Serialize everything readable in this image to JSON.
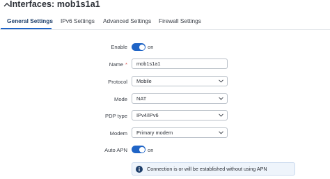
{
  "header": {
    "title": "Interfaces: mob1s1a1",
    "collapse_icon": "chevron-up-icon"
  },
  "tabs": [
    {
      "label": "General Settings",
      "active": true
    },
    {
      "label": "IPv6 Settings",
      "active": false
    },
    {
      "label": "Advanced Settings",
      "active": false
    },
    {
      "label": "Firewall Settings",
      "active": false
    }
  ],
  "form": {
    "enable": {
      "label": "Enable",
      "state": "on",
      "checked": true
    },
    "name": {
      "label": "Name",
      "required_mark": "*",
      "value": "mob1s1a1"
    },
    "protocol": {
      "label": "Protocol",
      "value": "Mobile"
    },
    "mode": {
      "label": "Mode",
      "value": "NAT"
    },
    "pdp_type": {
      "label": "PDP type",
      "value": "IPv4/IPv6"
    },
    "modem": {
      "label": "Modem",
      "value": "Primary modem"
    },
    "auto_apn": {
      "label": "Auto APN",
      "state": "on",
      "checked": true
    }
  },
  "info": {
    "icon": "info-icon",
    "text": "Connection is or will be established without using APN"
  },
  "colors": {
    "accent": "#1f64c6",
    "active_tab_text": "#1e3f6b",
    "required": "#d9534f",
    "info_bg": "#eef4fb"
  }
}
